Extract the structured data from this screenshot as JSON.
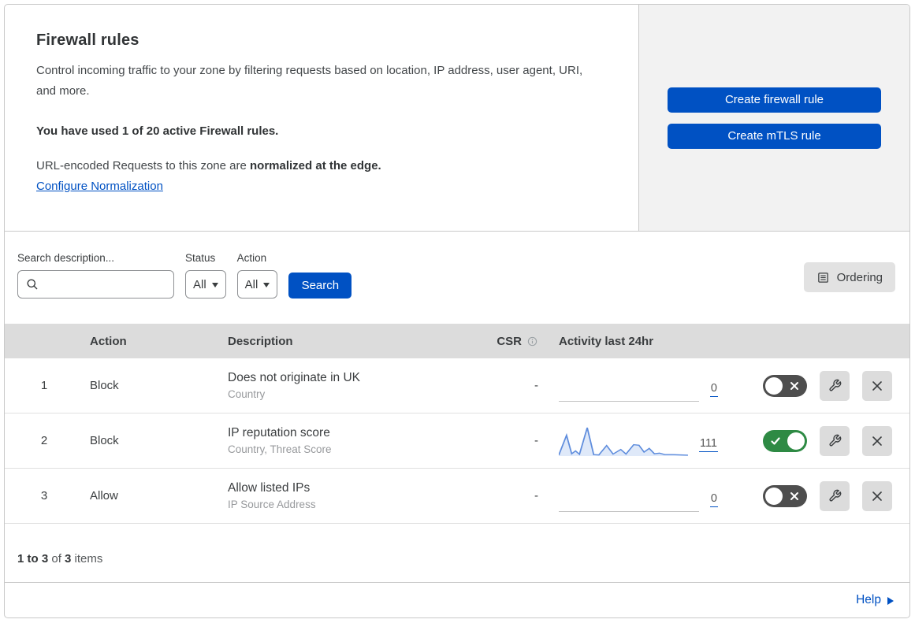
{
  "header": {
    "title": "Firewall rules",
    "description": "Control incoming traffic to your zone by filtering requests based on location, IP address, user agent, URI, and more.",
    "usage": "You have used 1 of 20 active Firewall rules.",
    "normalization_text": "URL-encoded Requests to this zone are ",
    "normalization_bold": "normalized at the edge.",
    "normalization_link": "Configure Normalization",
    "buttons": {
      "create_firewall": "Create firewall rule",
      "create_mtls": "Create mTLS rule"
    }
  },
  "filters": {
    "search_label": "Search description...",
    "search_value": "",
    "status_label": "Status",
    "status_value": "All",
    "action_label": "Action",
    "action_value": "All",
    "search_button": "Search",
    "ordering_button": "Ordering"
  },
  "table": {
    "columns": {
      "action": "Action",
      "description": "Description",
      "csr": "CSR",
      "activity": "Activity last 24hr"
    },
    "rows": [
      {
        "num": "1",
        "action": "Block",
        "description": "Does not originate in UK",
        "fields": "Country",
        "csr": "-",
        "count": "0",
        "enabled": false,
        "sparkline": []
      },
      {
        "num": "2",
        "action": "Block",
        "description": "IP reputation score",
        "fields": "Country, Threat Score",
        "csr": "-",
        "count": "111",
        "enabled": true,
        "sparkline": [
          [
            0,
            3
          ],
          [
            6,
            73
          ],
          [
            10,
            8
          ],
          [
            13,
            18
          ],
          [
            16,
            6
          ],
          [
            22,
            100
          ],
          [
            27,
            5
          ],
          [
            31,
            4
          ],
          [
            37,
            37
          ],
          [
            42,
            7
          ],
          [
            48,
            23
          ],
          [
            52,
            7
          ],
          [
            58,
            40
          ],
          [
            62,
            38
          ],
          [
            66,
            14
          ],
          [
            70,
            27
          ],
          [
            74,
            8
          ],
          [
            78,
            10
          ],
          [
            82,
            5
          ],
          [
            88,
            5
          ],
          [
            94,
            4
          ],
          [
            100,
            3
          ]
        ]
      },
      {
        "num": "3",
        "action": "Allow",
        "description": "Allow listed IPs",
        "fields": "IP Source Address",
        "csr": "-",
        "count": "0",
        "enabled": false,
        "sparkline": []
      }
    ]
  },
  "footer": {
    "range": "1 to 3",
    "of": " of ",
    "total": "3",
    "items_label": " items"
  },
  "help": {
    "label": "Help"
  },
  "icons": {
    "search-icon": "magnifier",
    "info-icon": "circled-i",
    "ordering-icon": "list-document",
    "wrench-icon": "wrench",
    "close-icon": "x-cross",
    "toggle-x-icon": "x-cross",
    "toggle-check-icon": "checkmark",
    "caret-down-icon": "filled-triangle-down",
    "help-arrow-icon": "filled-triangle-right"
  },
  "colors": {
    "primary_blue": "#0051c3",
    "toggle_on_green": "#2e8a44",
    "toggle_off_gray": "#4e4e4e",
    "panel_gray": "#f2f2f2",
    "table_header_gray": "#dcdcdc",
    "sparkline_stroke": "#5f8ddd",
    "sparkline_fill": "#dfe9f9"
  }
}
